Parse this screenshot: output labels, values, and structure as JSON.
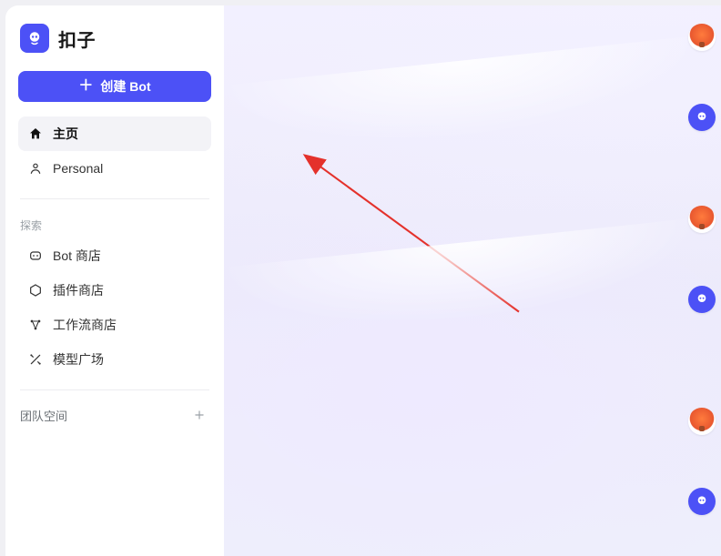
{
  "brand": {
    "name": "扣子"
  },
  "sidebar": {
    "create_label": "创建 Bot",
    "nav": [
      {
        "label": "主页"
      },
      {
        "label": "Personal"
      }
    ],
    "explore_title": "探索",
    "explore": [
      {
        "label": "Bot 商店"
      },
      {
        "label": "插件商店"
      },
      {
        "label": "工作流商店"
      },
      {
        "label": "模型广场"
      }
    ],
    "team_title": "团队空间"
  },
  "dock": {
    "items": [
      {
        "kind": "balloon"
      },
      {
        "kind": "bot"
      },
      {
        "kind": "balloon"
      },
      {
        "kind": "bot"
      },
      {
        "kind": "balloon"
      },
      {
        "kind": "bot"
      }
    ]
  },
  "colors": {
    "accent": "#4C51F6",
    "arrow": "#E4312B"
  }
}
